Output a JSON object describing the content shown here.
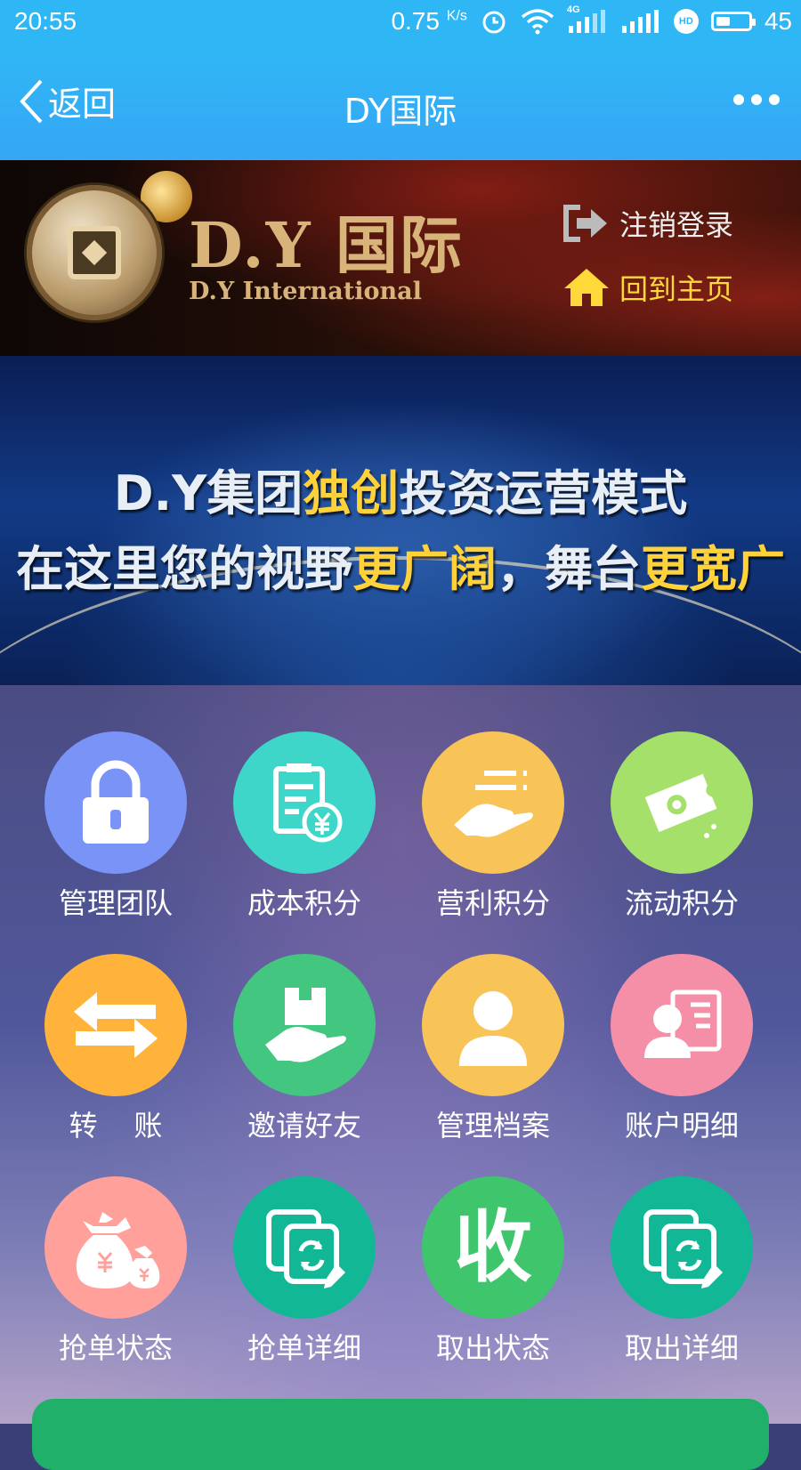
{
  "status_bar": {
    "time": "20:55",
    "speed": "0.75",
    "speed_unit": "K/s",
    "battery_level": 45,
    "battery_text": "45",
    "network_label": "4G",
    "hd_label": "HD"
  },
  "nav": {
    "back_label": "返回",
    "title": "DY国际"
  },
  "brand": {
    "name": "D.Y 国际",
    "subtitle": "D.Y International",
    "logout_label": "注销登录",
    "home_label": "回到主页"
  },
  "promo": {
    "line1_a": "D.Y集团",
    "line1_hl": "独创",
    "line1_b": "投资运营模式",
    "line2_a": "在这里您的视野",
    "line2_hl1": "更广阔",
    "line2_b": "，舞台",
    "line2_hl2": "更宽广"
  },
  "menu": [
    {
      "label": "管理团队",
      "icon": "lock-icon",
      "color": "#7a93f7"
    },
    {
      "label": "成本积分",
      "icon": "document-yuan-icon",
      "color": "#3ed6c9"
    },
    {
      "label": "营利积分",
      "icon": "hand-receive-icon",
      "color": "#f8c458"
    },
    {
      "label": "流动积分",
      "icon": "coupon-icon",
      "color": "#a5e06a"
    },
    {
      "label": "转    账",
      "icon": "transfer-arrows-icon",
      "color": "#ffb33a"
    },
    {
      "label": "邀请好友",
      "icon": "gift-hand-icon",
      "color": "#43c67f"
    },
    {
      "label": "管理档案",
      "icon": "user-profile-icon",
      "color": "#f8c458"
    },
    {
      "label": "账户明细",
      "icon": "id-card-icon",
      "color": "#f58fa8"
    },
    {
      "label": "抢单状态",
      "icon": "money-bag-icon",
      "color": "#ffa09a"
    },
    {
      "label": "抢单详细",
      "icon": "refresh-doc-icon",
      "color": "#12b895"
    },
    {
      "label": "取出状态",
      "icon": "collect-icon",
      "color": "#3fc66d"
    },
    {
      "label": "取出详细",
      "icon": "refresh-doc-icon",
      "color": "#12b895"
    }
  ],
  "collect_glyph": "收"
}
